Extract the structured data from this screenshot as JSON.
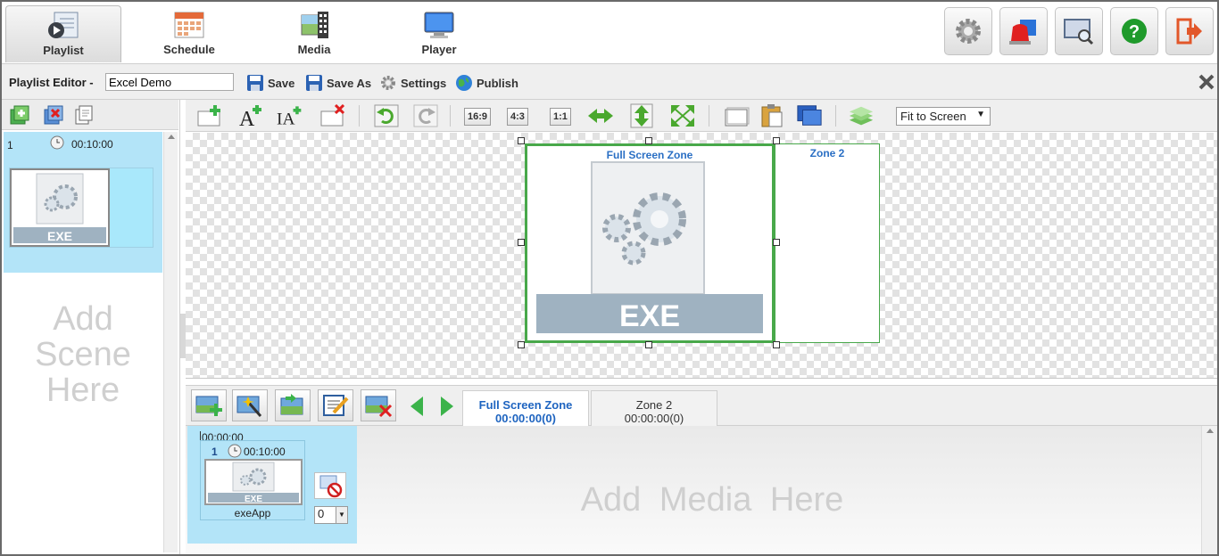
{
  "nav": {
    "tabs": [
      {
        "label": "Playlist",
        "icon": "playlist-icon",
        "active": true
      },
      {
        "label": "Schedule",
        "icon": "calendar-icon",
        "active": false
      },
      {
        "label": "Media",
        "icon": "media-film-icon",
        "active": false
      },
      {
        "label": "Player",
        "icon": "monitor-icon",
        "active": false
      }
    ],
    "actions": [
      "settings-gear-icon",
      "alarm-siren-icon",
      "screen-search-icon",
      "help-icon",
      "logout-icon"
    ]
  },
  "editor": {
    "title": "Playlist Editor -",
    "playlist_name": "Excel Demo",
    "save_label": "Save",
    "save_as_label": "Save As",
    "settings_label": "Settings",
    "publish_label": "Publish"
  },
  "scenes": {
    "items": [
      {
        "num": "1",
        "duration": "00:10:00",
        "thumb_label": "EXE"
      }
    ],
    "placeholder": "Add Scene Here"
  },
  "toolbar": {
    "ratios": [
      "16:9",
      "4:3",
      "1:1"
    ],
    "fit_option": "Fit to Screen"
  },
  "canvas": {
    "zone1_label": "Full Screen Zone",
    "zone2_label": "Zone 2",
    "zone1_content_label": "EXE"
  },
  "zone_tabs": [
    {
      "name": "Full Screen Zone",
      "time": "00:00:00(0)",
      "active": true
    },
    {
      "name": "Zone 2",
      "time": "00:00:00(0)",
      "active": false
    }
  ],
  "timeline": {
    "start_time": "00:00:00",
    "media": {
      "index": "1",
      "duration": "00:10:00",
      "name": "exeApp",
      "thumb_label": "EXE"
    },
    "loop_value": "0",
    "placeholder": "Add Media Here"
  },
  "colors": {
    "accent_green": "#48a84a",
    "selection_blue": "#b3e4f8",
    "link_blue": "#1e64c0"
  }
}
